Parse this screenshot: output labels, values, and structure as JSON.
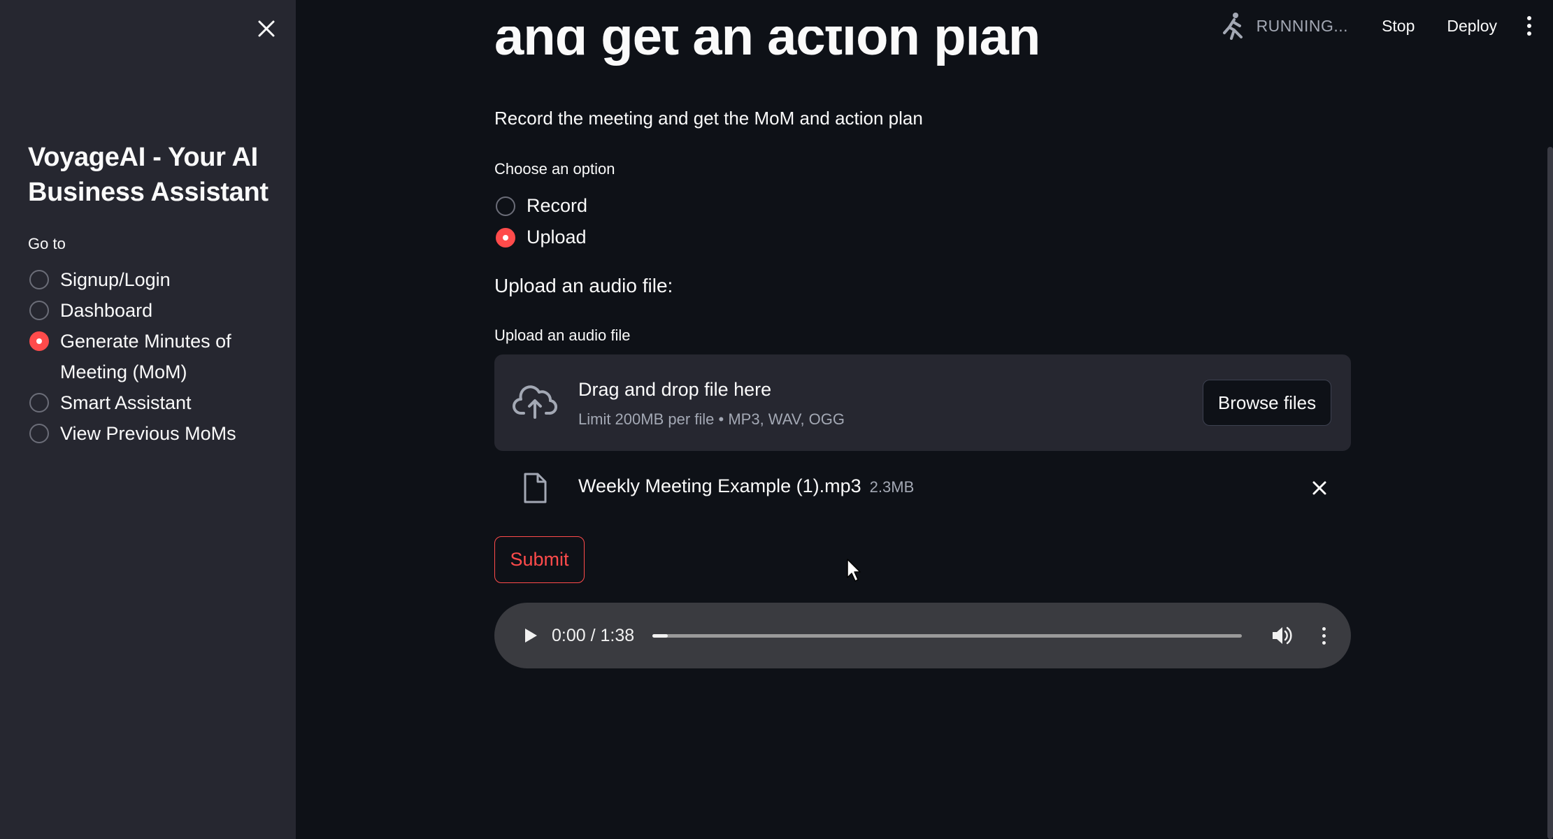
{
  "sidebar": {
    "title": "VoyageAI - Your AI Business Assistant",
    "goto_label": "Go to",
    "items": [
      {
        "label": "Signup/Login",
        "selected": false
      },
      {
        "label": "Dashboard",
        "selected": false
      },
      {
        "label": "Generate Minutes of Meeting (MoM)",
        "selected": true
      },
      {
        "label": "Smart Assistant",
        "selected": false
      },
      {
        "label": "View Previous MoMs",
        "selected": false
      }
    ]
  },
  "header": {
    "status": "RUNNING...",
    "stop_label": "Stop",
    "deploy_label": "Deploy"
  },
  "main": {
    "title": "and get an action plan",
    "subtitle": "Record the meeting and get the MoM and action plan",
    "choose_label": "Choose an option",
    "options": [
      {
        "label": "Record",
        "selected": false
      },
      {
        "label": "Upload",
        "selected": true
      }
    ],
    "upload_heading": "Upload an audio file:",
    "uploader": {
      "label": "Upload an audio file",
      "drop_title": "Drag and drop file here",
      "limit_text": "Limit 200MB per file • MP3, WAV, OGG",
      "browse_label": "Browse files"
    },
    "file": {
      "name": "Weekly Meeting Example (1).mp3",
      "size": "2.3MB"
    },
    "submit_label": "Submit",
    "audio": {
      "time": "0:00 / 1:38",
      "progress": 0.0
    }
  },
  "colors": {
    "accent": "#ff4b4b",
    "background": "#0e1117",
    "sidebar": "#262730"
  }
}
